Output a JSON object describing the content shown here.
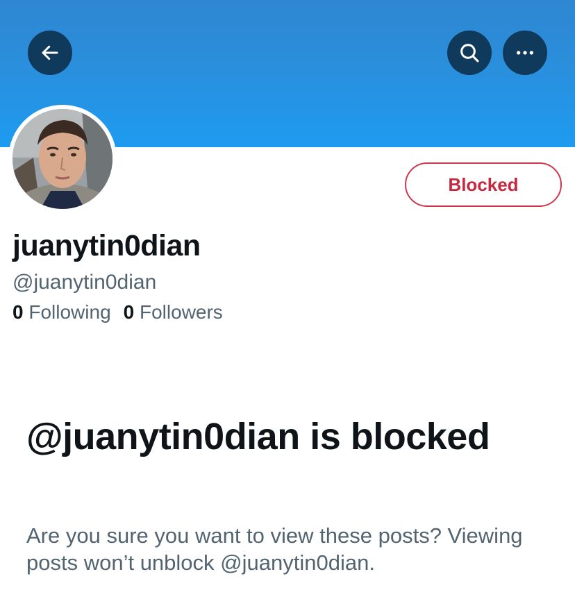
{
  "header": {
    "back_icon": "arrow-left-icon",
    "search_icon": "search-icon",
    "more_icon": "more-horizontal-icon",
    "banner_color": "#1d9bf0",
    "button_bg": "#0f3a5c"
  },
  "profile": {
    "display_name": "juanytin0dian",
    "handle": "@juanytin0dian",
    "following_count": "0",
    "following_label": "Following",
    "followers_count": "0",
    "followers_label": "Followers",
    "blocked_button_label": "Blocked",
    "blocked_color": "#c6283d"
  },
  "blocked_notice": {
    "title": "@juanytin0dian is blocked",
    "description": "Are you sure you want to view these posts? Viewing posts won’t unblock @juanytin0dian."
  }
}
